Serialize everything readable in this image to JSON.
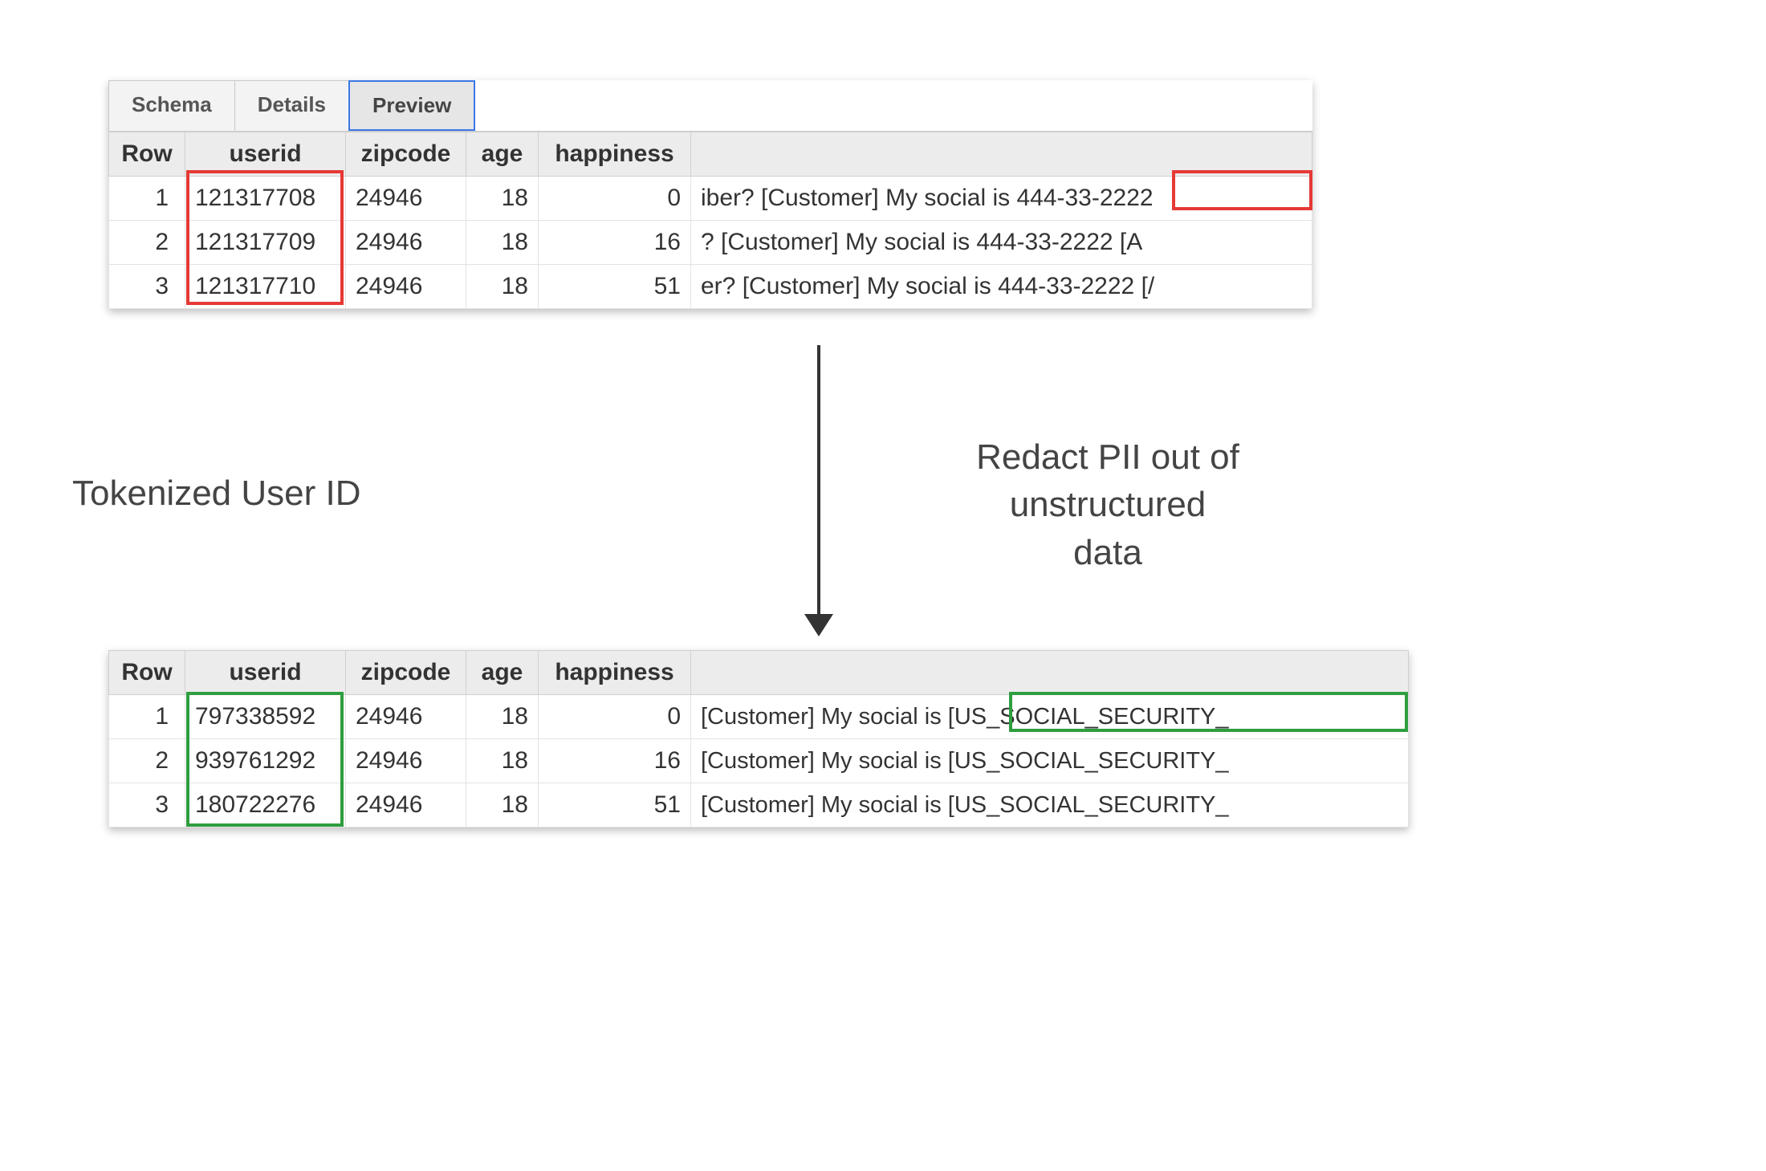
{
  "tabs": {
    "schema": "Schema",
    "details": "Details",
    "preview": "Preview"
  },
  "columns": {
    "row": "Row",
    "userid": "userid",
    "zipcode": "zipcode",
    "age": "age",
    "happiness": "happiness"
  },
  "top_rows": [
    {
      "row": "1",
      "userid": "121317708",
      "zipcode": "24946",
      "age": "18",
      "happiness": "0",
      "text": "iber? [Customer] My social is 444-33-2222"
    },
    {
      "row": "2",
      "userid": "121317709",
      "zipcode": "24946",
      "age": "18",
      "happiness": "16",
      "text": "? [Customer] My social is 444-33-2222 [A"
    },
    {
      "row": "3",
      "userid": "121317710",
      "zipcode": "24946",
      "age": "18",
      "happiness": "51",
      "text": "er? [Customer] My social is 444-33-2222 [/"
    }
  ],
  "bottom_rows": [
    {
      "row": "1",
      "userid": "797338592",
      "zipcode": "24946",
      "age": "18",
      "happiness": "0",
      "text": "[Customer] My social is [US_SOCIAL_SECURITY_"
    },
    {
      "row": "2",
      "userid": "939761292",
      "zipcode": "24946",
      "age": "18",
      "happiness": "16",
      "text": "[Customer] My social is [US_SOCIAL_SECURITY_"
    },
    {
      "row": "3",
      "userid": "180722276",
      "zipcode": "24946",
      "age": "18",
      "happiness": "51",
      "text": "[Customer] My social is [US_SOCIAL_SECURITY_"
    }
  ],
  "labels": {
    "tokenized": "Tokenized User ID",
    "redact_line1": "Redact PII out of",
    "redact_line2": "unstructured",
    "redact_line3": "data"
  },
  "highlight_colors": {
    "red": "#e53935",
    "green": "#2e9e3f"
  }
}
